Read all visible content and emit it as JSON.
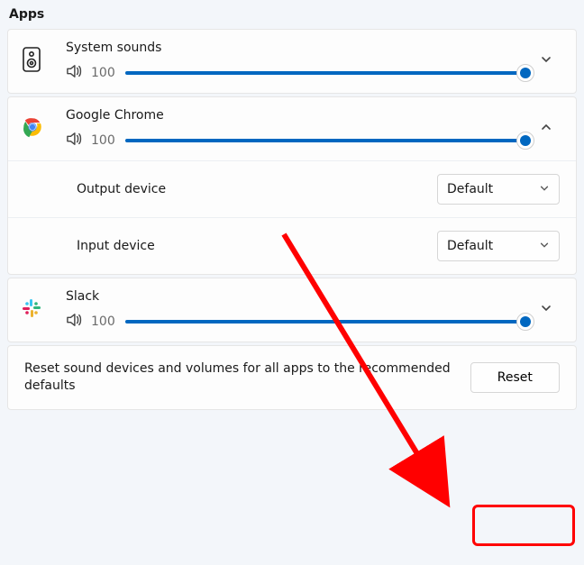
{
  "section_title": "Apps",
  "apps": [
    {
      "name": "System sounds",
      "volume": "100"
    },
    {
      "name": "Google Chrome",
      "volume": "100"
    },
    {
      "name": "Slack",
      "volume": "100"
    }
  ],
  "devices": {
    "output_label": "Output device",
    "output_value": "Default",
    "input_label": "Input device",
    "input_value": "Default"
  },
  "reset": {
    "text": "Reset sound devices and volumes for all apps to the recommended defaults",
    "button": "Reset"
  }
}
